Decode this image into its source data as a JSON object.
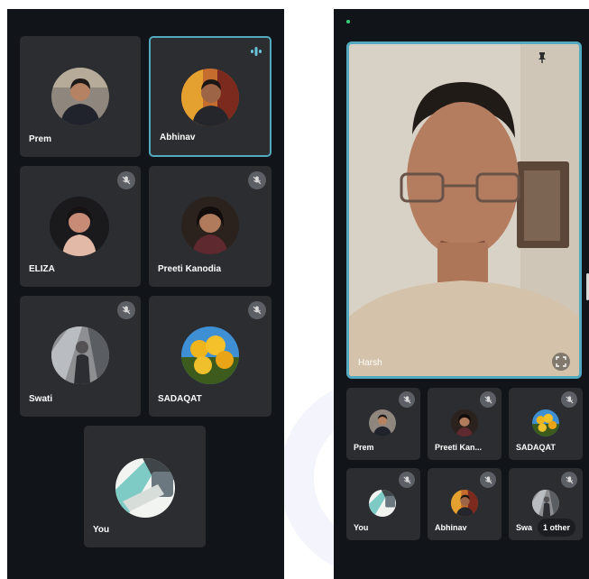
{
  "left_screen": {
    "participants": [
      {
        "name": "Prem",
        "muted": false,
        "active_speaker": false
      },
      {
        "name": "Abhinav",
        "muted": false,
        "active_speaker": true
      },
      {
        "name": "ELIZA",
        "muted": true,
        "active_speaker": false
      },
      {
        "name": "Preeti Kanodia",
        "muted": true,
        "active_speaker": false
      },
      {
        "name": "Swati",
        "muted": true,
        "active_speaker": false
      },
      {
        "name": "SADAQAT",
        "muted": true,
        "active_speaker": false
      },
      {
        "name": "You",
        "muted": false,
        "active_speaker": false
      }
    ]
  },
  "right_screen": {
    "main_video": {
      "name": "Harsh"
    },
    "grid": [
      {
        "name": "Prem",
        "muted": true
      },
      {
        "name": "Preeti Kan...",
        "muted": true
      },
      {
        "name": "SADAQAT",
        "muted": true
      },
      {
        "name": "You",
        "muted": true
      },
      {
        "name": "Abhinav",
        "muted": true
      },
      {
        "name": "Swa",
        "muted": true
      }
    ],
    "others_label": "1 other"
  },
  "colors": {
    "background": "#11151a",
    "tile": "#2b2d31",
    "active_border": "#53a9c0",
    "status_dot": "#33d17a"
  }
}
